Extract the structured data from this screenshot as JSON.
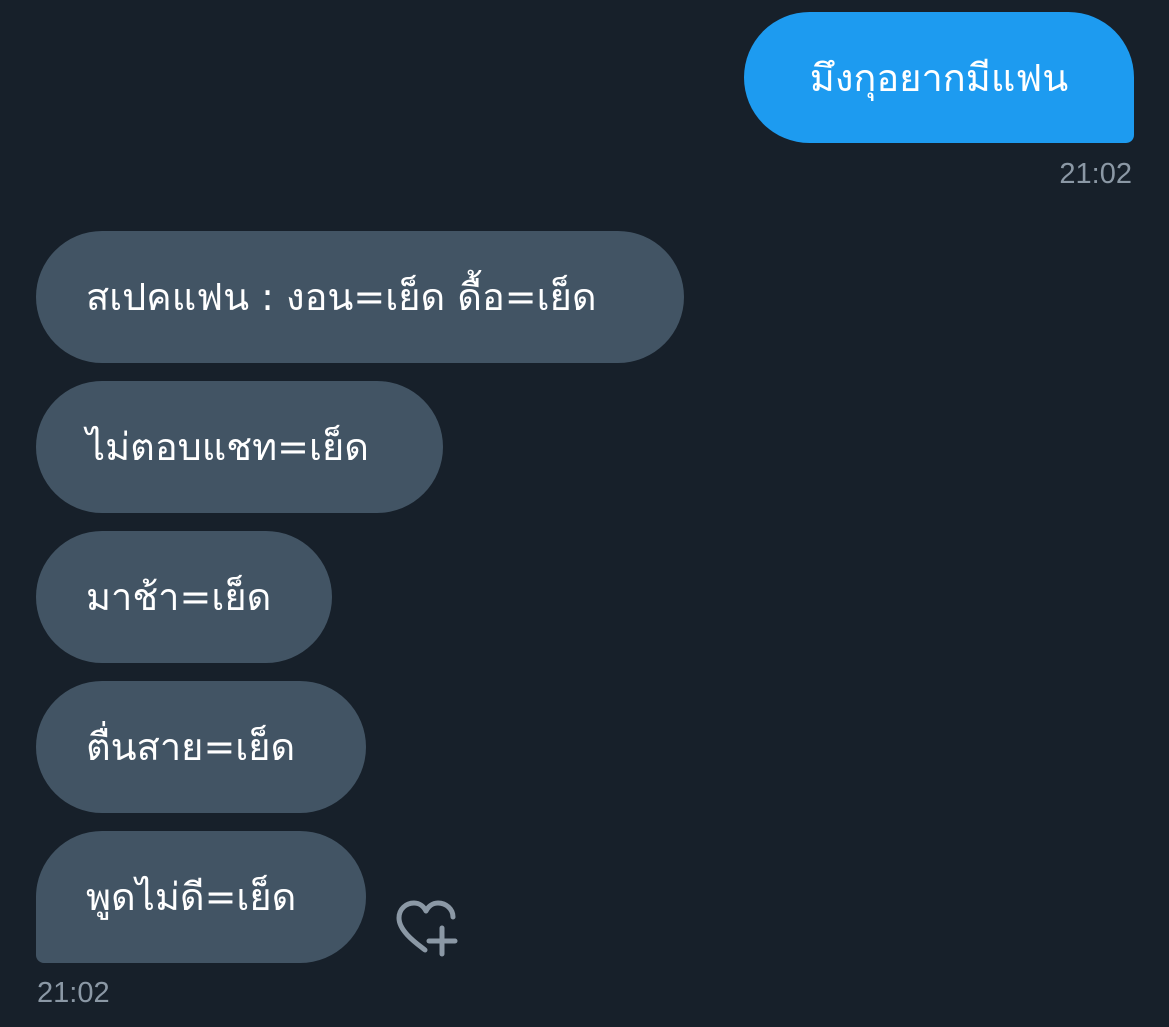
{
  "conversation": {
    "sent": [
      {
        "text": "มึงกุอยากมีแฟน"
      }
    ],
    "sent_time": "21:02",
    "received": [
      {
        "text": "สเปคแฟน : งอน=เย็ด ดื้อ=เย็ด"
      },
      {
        "text": "ไม่ตอบแชท=เย็ด"
      },
      {
        "text": "มาช้า=เย็ด"
      },
      {
        "text": "ตื่นสาย=เย็ด"
      },
      {
        "text": "พูดไม่ดี=เย็ด"
      }
    ],
    "received_time": "21:02"
  },
  "icons": {
    "react": "heart-plus-icon"
  },
  "colors": {
    "background": "#17202a",
    "sent_bubble": "#1d9bf0",
    "received_bubble": "#425464",
    "timestamp": "#8b98a5"
  }
}
